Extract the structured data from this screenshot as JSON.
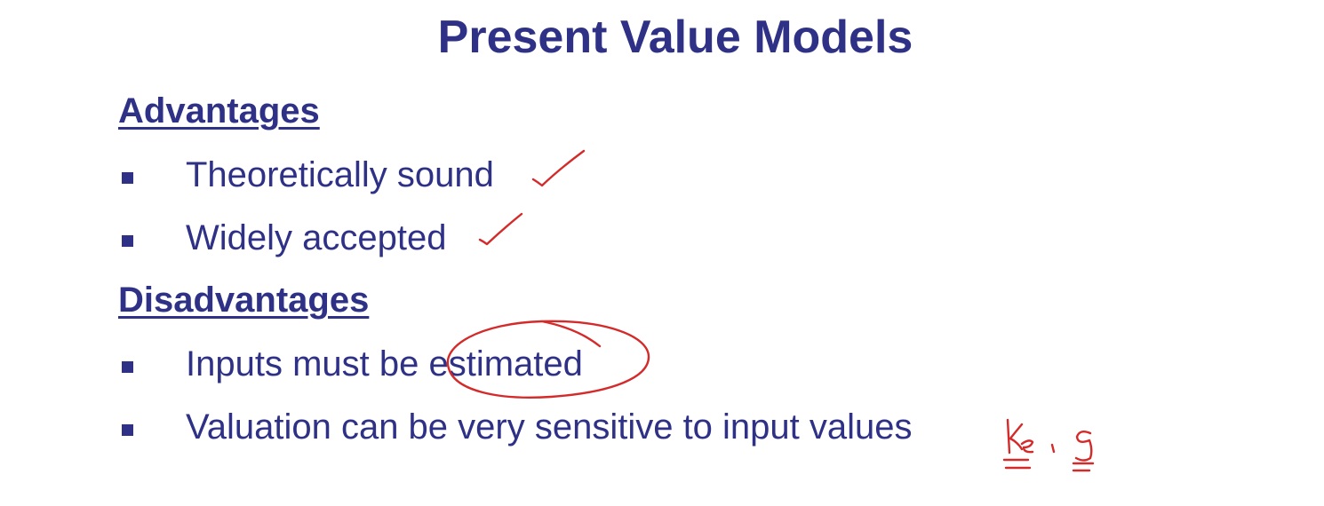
{
  "slide": {
    "title": "Present Value Models",
    "advantages": {
      "heading": "Advantages",
      "items": [
        {
          "text": "Theoretically sound"
        },
        {
          "text": "Widely accepted"
        }
      ]
    },
    "disadvantages": {
      "heading": "Disadvantages",
      "items": [
        {
          "text": "Inputs must be estimated"
        },
        {
          "text": "Valuation can be very sensitive to input values"
        }
      ]
    },
    "annotations": {
      "color": "#d42a2a",
      "handwritten_note": "ke , g"
    }
  },
  "colors": {
    "text": "#2e3185",
    "background": "#ffffff",
    "ink": "#d42a2a"
  }
}
